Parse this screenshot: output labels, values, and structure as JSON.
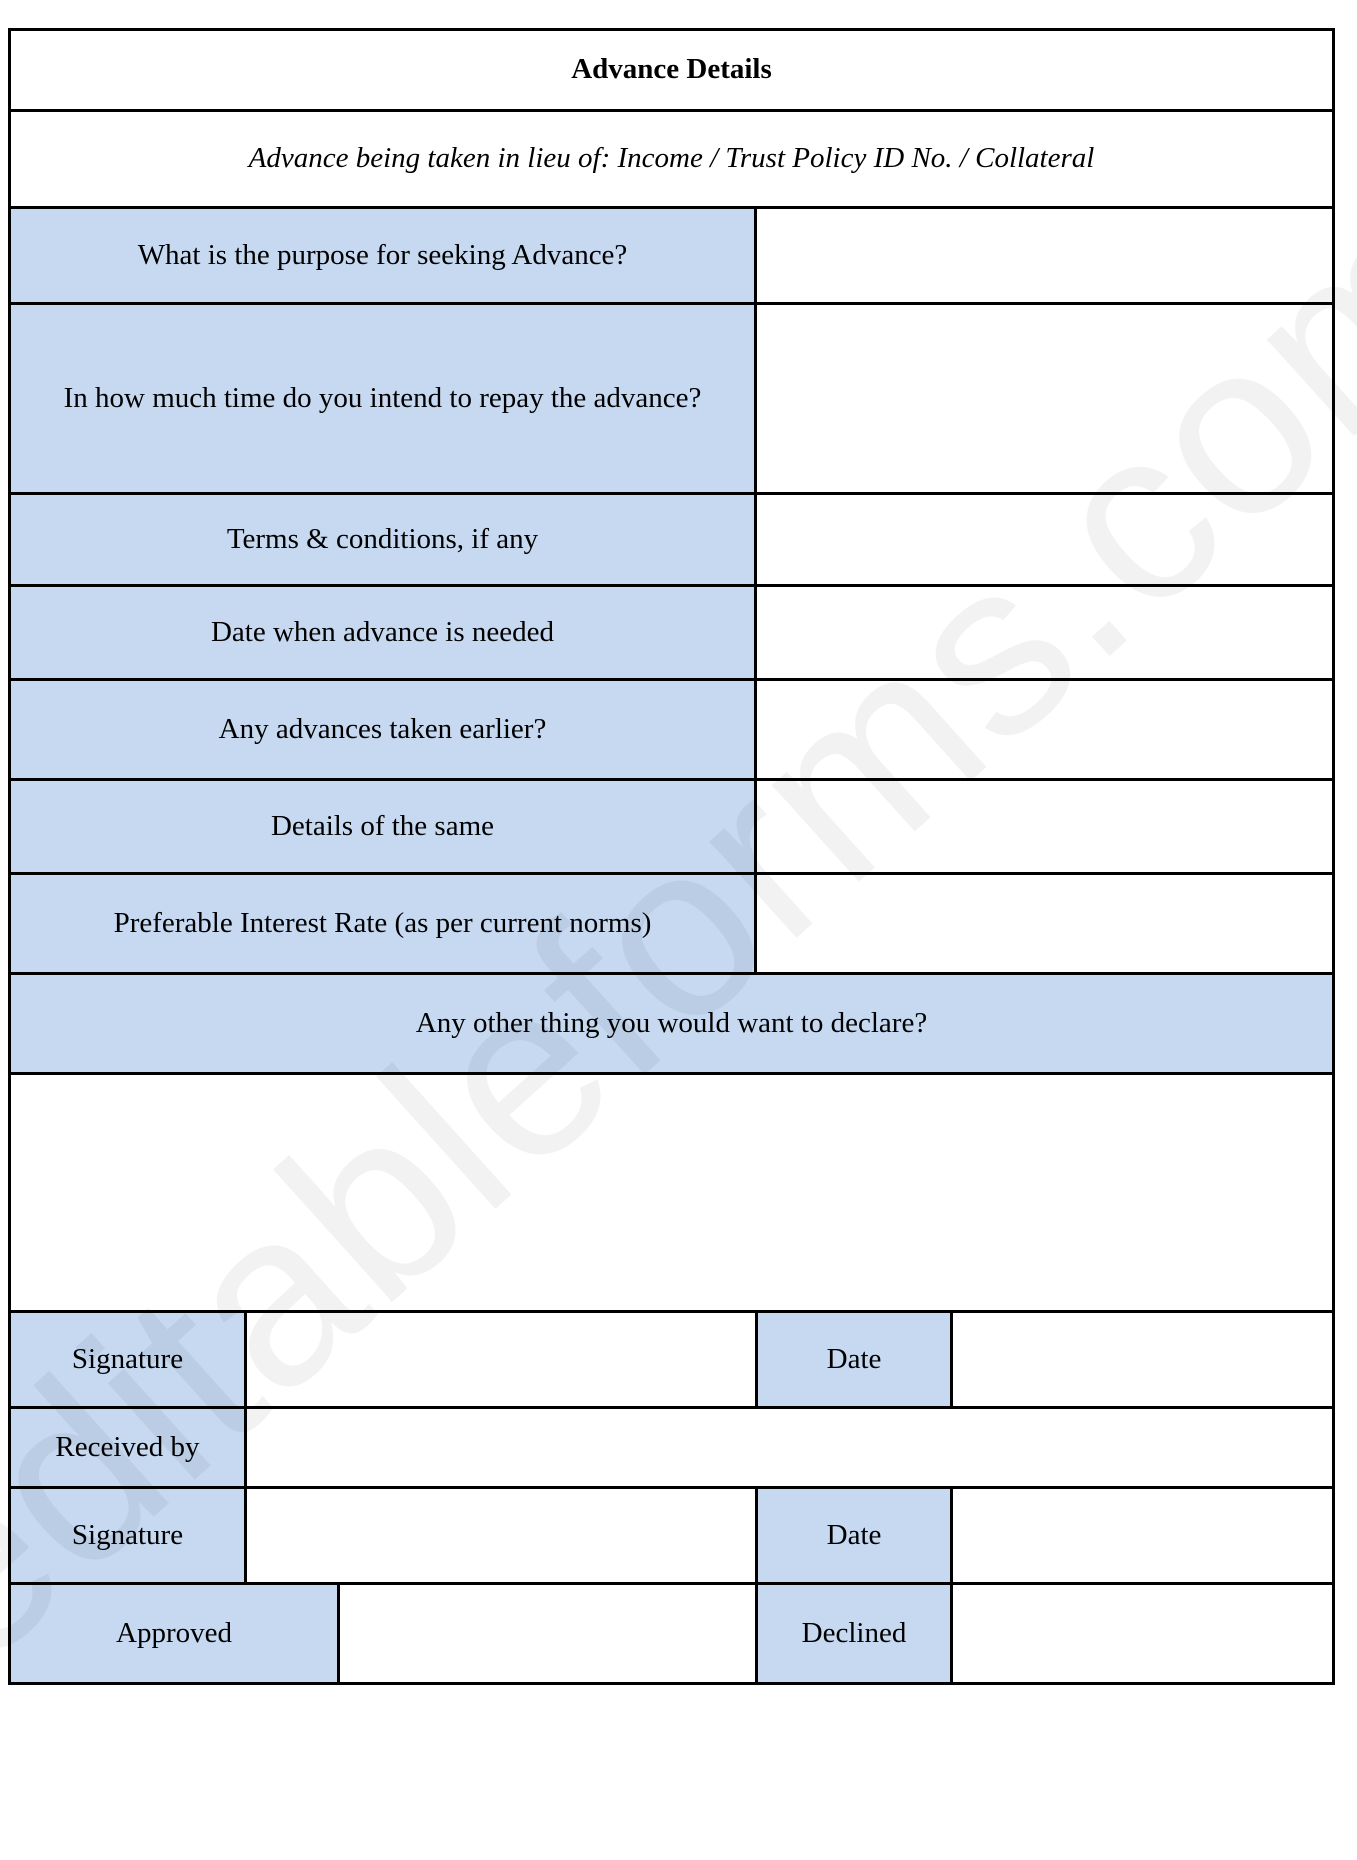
{
  "document": {
    "title": "Advance Details",
    "subtitle": "Advance being taken in lieu of: Income / Trust Policy ID No. / Collateral",
    "watermark": "editableforms.com",
    "accent_color": "#c6d9f1",
    "border_color": "#000000"
  },
  "fields": [
    {
      "label": "What is the purpose for seeking Advance?",
      "value": ""
    },
    {
      "label": "In how much time do you intend to repay the advance?",
      "value": ""
    },
    {
      "label": "Terms & conditions, if any",
      "value": ""
    },
    {
      "label": "Date when advance is needed",
      "value": ""
    },
    {
      "label": "Any advances taken earlier?",
      "value": ""
    },
    {
      "label": "Details of the same",
      "value": ""
    },
    {
      "label": "Preferable Interest Rate (as per current norms)",
      "value": ""
    }
  ],
  "declaration": {
    "prompt": "Any other thing you would want to declare?",
    "value": ""
  },
  "signoff": {
    "applicant_signature_label": "Signature",
    "applicant_signature_value": "",
    "applicant_date_label": "Date",
    "applicant_date_value": "",
    "received_by_label": "Received by",
    "received_by_value": "",
    "receiver_signature_label": "Signature",
    "receiver_signature_value": "",
    "receiver_date_label": "Date",
    "receiver_date_value": "",
    "approved_label": "Approved",
    "approved_value": "",
    "declined_label": "Declined",
    "declined_value": ""
  }
}
